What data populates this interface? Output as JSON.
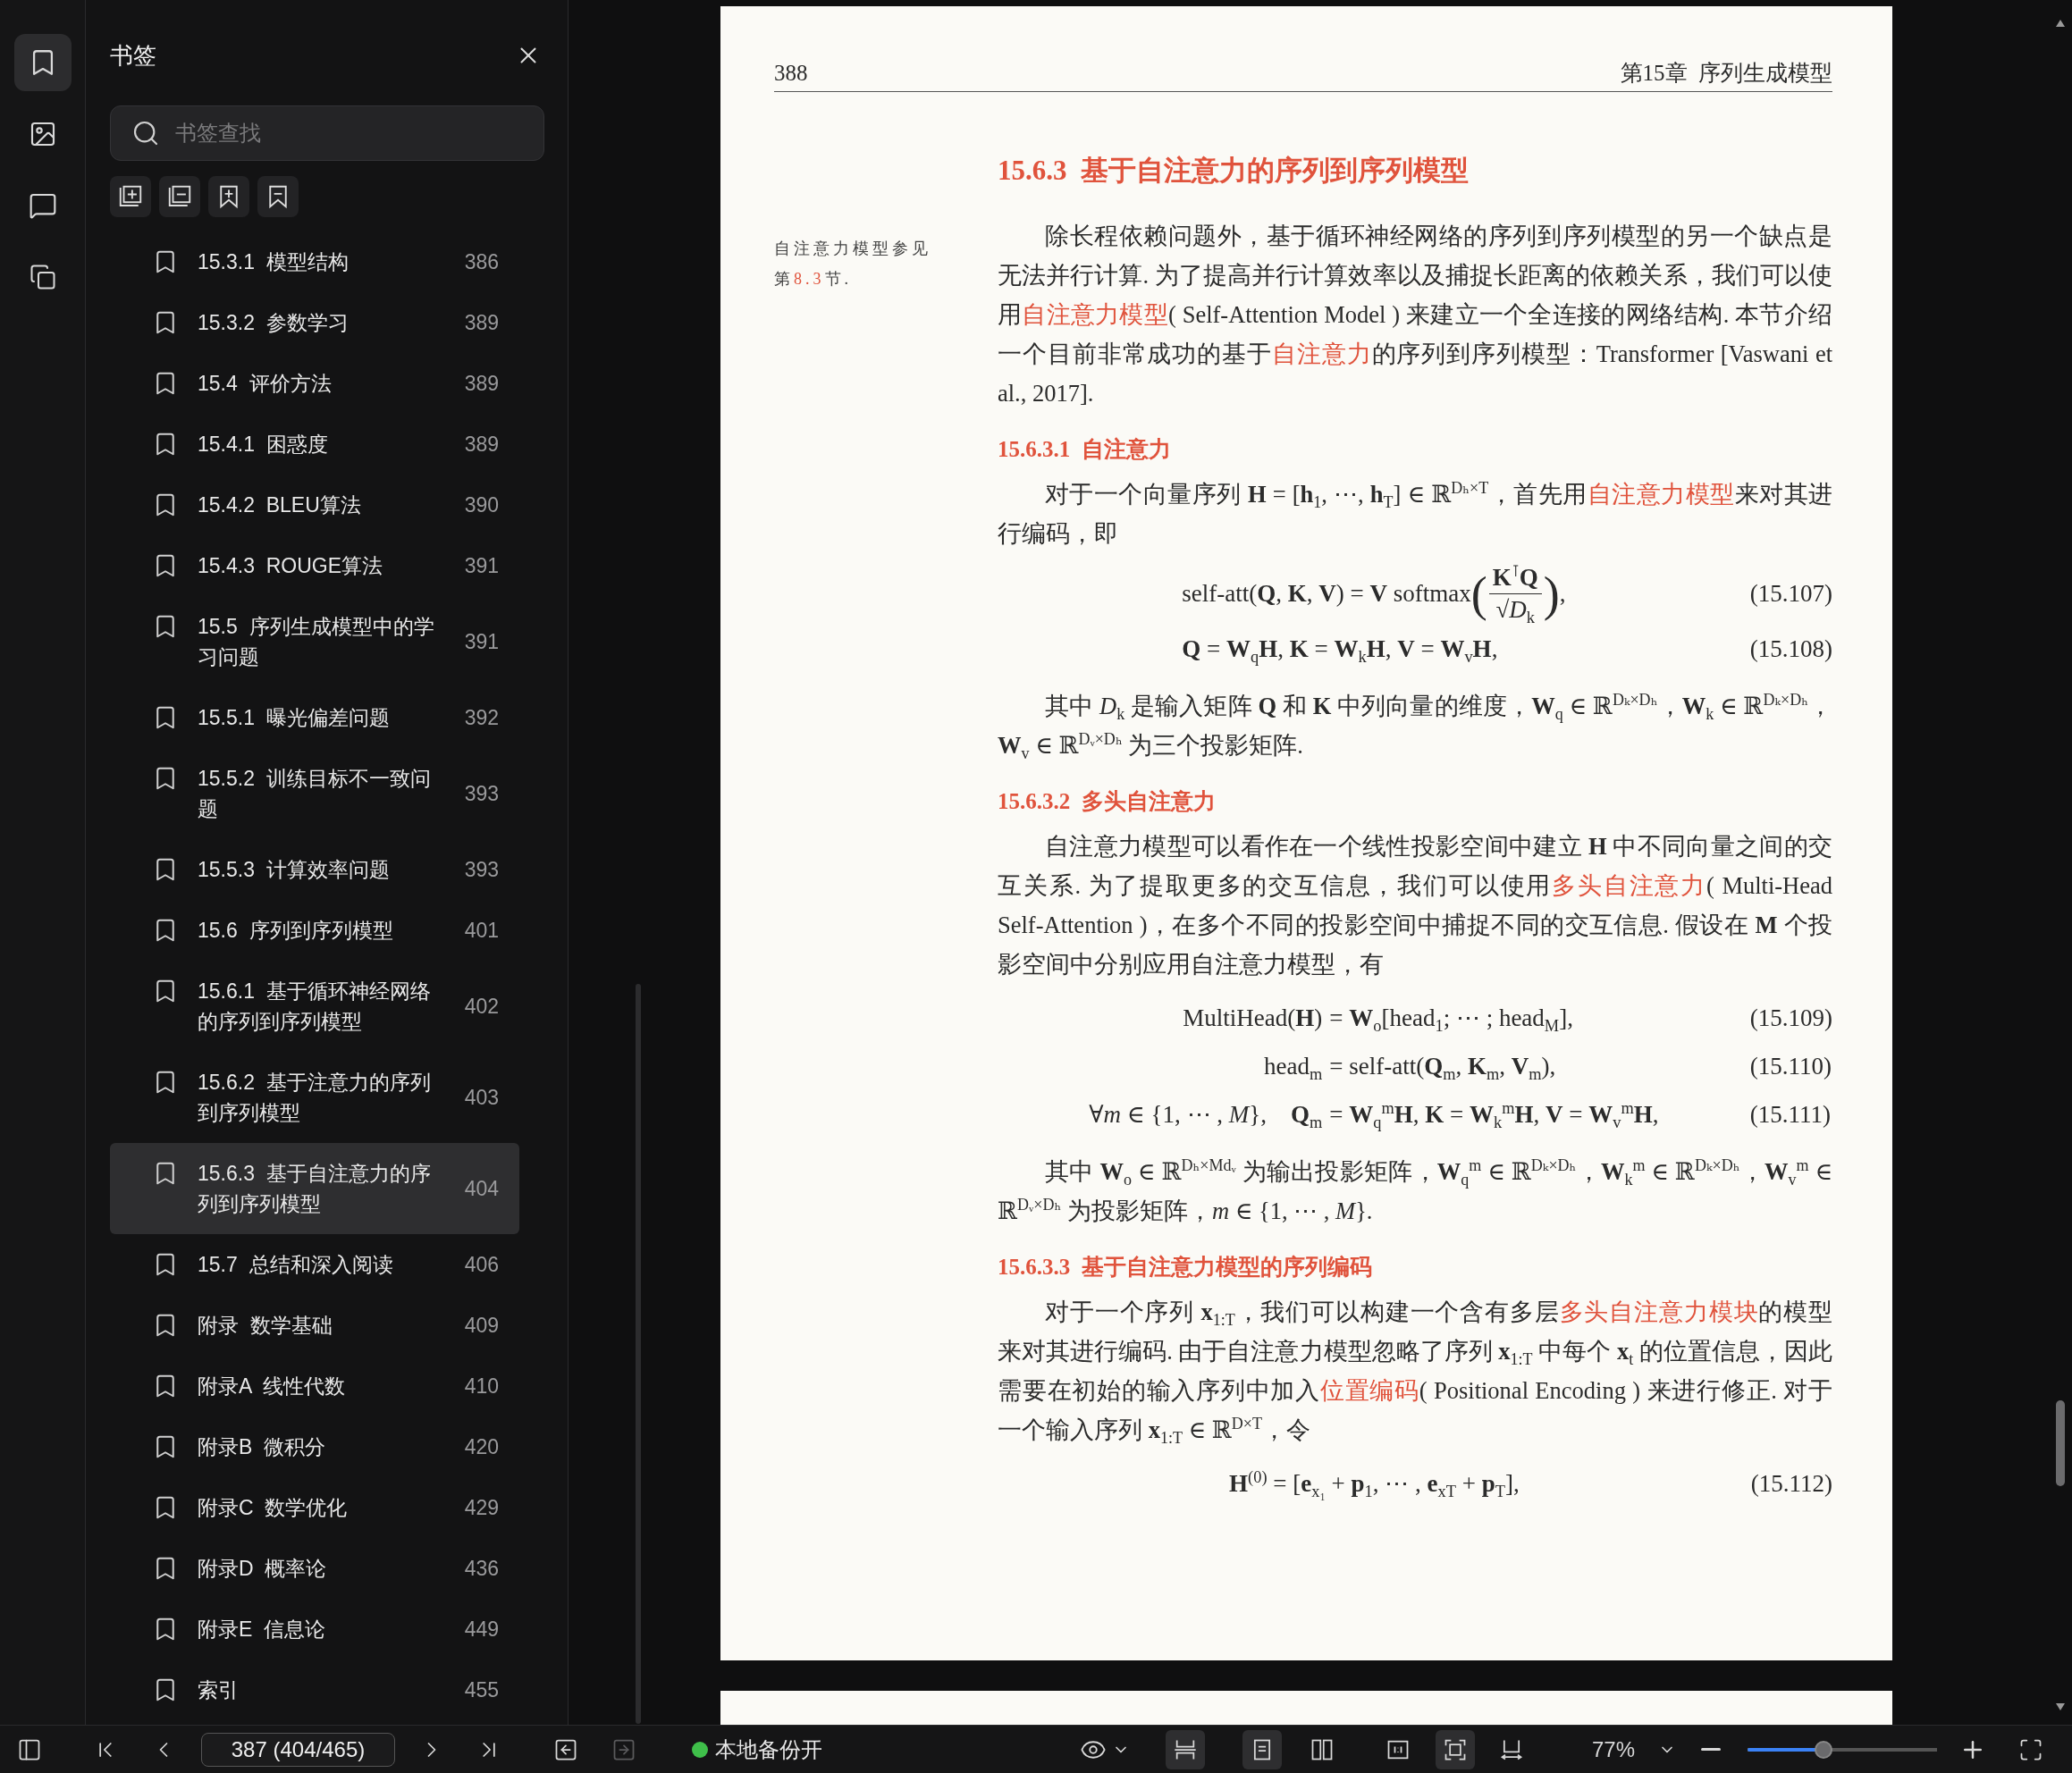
{
  "rail": [
    {
      "kind": "bookmarks",
      "selected": true
    },
    {
      "kind": "images",
      "selected": false
    },
    {
      "kind": "comments",
      "selected": false
    },
    {
      "kind": "copy",
      "selected": false
    }
  ],
  "panel": {
    "title": "书签",
    "search": {
      "placeholder": "书签查找"
    },
    "tools": [
      {
        "kind": "expand"
      },
      {
        "kind": "collapse"
      },
      {
        "kind": "add"
      },
      {
        "kind": "remove"
      }
    ],
    "bookmarks": [
      {
        "label": "15.3.1  模型结构",
        "page": "386",
        "selected": false
      },
      {
        "label": "15.3.2  参数学习",
        "page": "389",
        "selected": false
      },
      {
        "label": "15.4  评价方法",
        "page": "389",
        "selected": false
      },
      {
        "label": "15.4.1  困惑度",
        "page": "389",
        "selected": false
      },
      {
        "label": "15.4.2  BLEU算法",
        "page": "390",
        "selected": false
      },
      {
        "label": "15.4.3  ROUGE算法",
        "page": "391",
        "selected": false
      },
      {
        "label": "15.5  序列生成模型中的学习问题",
        "page": "391",
        "selected": false
      },
      {
        "label": "15.5.1  曝光偏差问题",
        "page": "392",
        "selected": false
      },
      {
        "label": "15.5.2  训练目标不一致问题",
        "page": "393",
        "selected": false
      },
      {
        "label": "15.5.3  计算效率问题",
        "page": "393",
        "selected": false
      },
      {
        "label": "15.6  序列到序列模型",
        "page": "401",
        "selected": false
      },
      {
        "label": "15.6.1  基于循环神经网络的序列到序列模型",
        "page": "402",
        "selected": false
      },
      {
        "label": "15.6.2  基于注意力的序列到序列模型",
        "page": "403",
        "selected": false
      },
      {
        "label": "15.6.3  基于自注意力的序列到序列模型",
        "page": "404",
        "selected": true
      },
      {
        "label": "15.7  总结和深入阅读",
        "page": "406",
        "selected": false
      },
      {
        "label": "附录  数学基础",
        "page": "409",
        "selected": false
      },
      {
        "label": "附录A  线性代数",
        "page": "410",
        "selected": false
      },
      {
        "label": "附录B  微积分",
        "page": "420",
        "selected": false
      },
      {
        "label": "附录C  数学优化",
        "page": "429",
        "selected": false
      },
      {
        "label": "附录D  概率论",
        "page": "436",
        "selected": false
      },
      {
        "label": "附录E  信息论",
        "page": "449",
        "selected": false
      },
      {
        "label": "索引",
        "page": "455",
        "selected": false
      }
    ]
  },
  "page": {
    "header": {
      "page_number": "388",
      "chapter": "第15章  序列生成模型"
    },
    "margin_note": [
      {
        "text": "自注意力模型参见第",
        "link": false
      },
      {
        "text": "8.3",
        "link": true
      },
      {
        "text": "节.",
        "link": false
      }
    ],
    "blocks": [
      {
        "kind": "section",
        "text": "15.6.3  基于自注意力的序列到序列模型"
      },
      {
        "kind": "paragraph",
        "segments": [
          {
            "text": "除长程依赖问题外，基于循环神经网络的序列到序列模型的另一个缺点是无法并行计算. 为了提高并行计算效率以及捕捉长距离的依赖关系，我们可以使用",
            "link": false
          },
          {
            "text": "自注意力模型",
            "link": true
          },
          {
            "text": "( Self-Attention Model ) 来建立一个全连接的网络结构. 本节介绍一个目前非常成功的基于",
            "link": false
          },
          {
            "text": "自注意力",
            "link": true
          },
          {
            "text": "的序列到序列模型：Transformer [Vaswani et al., 2017].",
            "link": false
          }
        ]
      },
      {
        "kind": "subsection",
        "text": "15.6.3.1  自注意力"
      },
      {
        "kind": "paragraph",
        "segments": [
          {
            "text": "对于一个向量序列 **H** = [**h**$_{1}$, ⋯, **h**$_{T}$] ∈ ℝ$^{Dₕ×T}$，首先用",
            "link": false
          },
          {
            "text": "自注意力模型",
            "link": true
          },
          {
            "text": "来对其进行编码，即",
            "link": false
          }
        ]
      },
      {
        "kind": "equations",
        "rows": [
          {
            "parts": [
              {
                "kind": "text",
                "text": "self-att(**Q**, **K**, **V**) = **V** softmax"
              },
              {
                "kind": "delim",
                "text": "("
              },
              {
                "kind": "fraction",
                "numerator": "**K**$^{⊺}$**Q**",
                "denominator": "√*D*$_{k}$"
              },
              {
                "kind": "delim",
                "text": ")"
              },
              {
                "kind": "text",
                "text": ","
              }
            ],
            "number": "(15.107)"
          },
          {
            "parts": [
              {
                "kind": "text",
                "text": "**Q** = **W**$_{q}$**H**, **K** = **W**$_{k}$**H**, **V** = **W**$_{v}$**H**,"
              }
            ],
            "number": "(15.108)"
          }
        ]
      },
      {
        "kind": "paragraph",
        "segments": [
          {
            "text": "其中 *D*$_{k}$ 是输入矩阵 **Q** 和 **K** 中列向量的维度，**W**$_{q}$ ∈ ℝ$^{Dₖ×Dₕ}$，**W**$_{k}$ ∈ ℝ$^{Dₖ×Dₕ}$，**W**$_{v}$ ∈ ℝ$^{Dᵥ×Dₕ}$ 为三个投影矩阵.",
            "link": false
          }
        ]
      },
      {
        "kind": "subsection",
        "text": "15.6.3.2  多头自注意力"
      },
      {
        "kind": "paragraph",
        "segments": [
          {
            "text": "自注意力模型可以看作在一个线性投影空间中建立 **H** 中不同向量之间的交互关系. 为了提取更多的交互信息，我们可以使用",
            "link": false
          },
          {
            "text": "多头自注意力",
            "link": true
          },
          {
            "text": "( Multi-Head Self-Attention )，在多个不同的投影空间中捕捉不同的交互信息. 假设在 **M** 个投影空间中分别应用自注意力模型，有",
            "link": false
          }
        ]
      },
      {
        "kind": "equations",
        "rows": [
          {
            "lhs": "MultiHead(**H**)",
            "parts": [
              {
                "kind": "text",
                "text": "= **W**$_{o}$[head$_{1}$; ⋯ ; head$_{M}$],"
              }
            ],
            "number": "(15.109)"
          },
          {
            "lhs": "head$_{m}$",
            "parts": [
              {
                "kind": "text",
                "text": "= self-att(**Q**$_{m}$, **K**$_{m}$, **V**$_{m}$),"
              }
            ],
            "number": "(15.110)"
          },
          {
            "lhs": "∀*m* ∈ {1, ⋯ , *M*},    **Q**$_{m}$",
            "parts": [
              {
                "kind": "text",
                "text": "= **W**$_{q}$$^{m}$**H**, **K** = **W**$_{k}$$^{m}$**H**, **V** = **W**$_{v}$$^{m}$**H**,"
              }
            ],
            "number": "(15.111)"
          }
        ]
      },
      {
        "kind": "paragraph",
        "segments": [
          {
            "text": "其中 **W**$_{o}$ ∈ ℝ$^{Dₕ×Mdᵥ}$ 为输出投影矩阵，**W**$_{q}$$^{m}$ ∈ ℝ$^{Dₖ×Dₕ}$，**W**$_{k}$$^{m}$ ∈ ℝ$^{Dₖ×Dₕ}$，**W**$_{v}$$^{m}$ ∈ ℝ$^{Dᵥ×Dₕ}$ 为投影矩阵，*m* ∈ {1, ⋯ , *M*}.",
            "link": false
          }
        ]
      },
      {
        "kind": "subsection",
        "text": "15.6.3.3  基于自注意力模型的序列编码"
      },
      {
        "kind": "paragraph",
        "segments": [
          {
            "text": "对于一个序列 **x**$_{1:T}$，我们可以构建一个含有多层",
            "link": false
          },
          {
            "text": "多头自注意力模块",
            "link": true
          },
          {
            "text": "的模型来对其进行编码. 由于自注意力模型忽略了序列 **x**$_{1:T}$ 中每个 **x**$_{t}$ 的位置信息，因此需要在初始的输入序列中加入",
            "link": false
          },
          {
            "text": "位置编码",
            "link": true
          },
          {
            "text": "( Positional Encoding ) 来进行修正. 对于一个输入序列 **x**$_{1:T}$ ∈ ℝ$^{D×T}$，令",
            "link": false
          }
        ]
      },
      {
        "kind": "equations",
        "rows": [
          {
            "parts": [
              {
                "kind": "text",
                "text": "**H**$^{(0)}$ = [**e**$_{x₁}$ + **p**$_{1}$, ⋯ , **e**$_{xT}$ + **p**$_{T}$],"
              }
            ],
            "number": "(15.112)"
          }
        ]
      }
    ]
  },
  "bottom_bar": {
    "nav": [
      {
        "kind": "back",
        "disabled": false
      },
      {
        "kind": "forward",
        "disabled": true
      }
    ],
    "page_field": {
      "value": "387 (404/465)"
    },
    "backup": {
      "label": "本地备份开",
      "on": true
    },
    "views": [
      {
        "kind": "split",
        "selected": true
      },
      {
        "kind": "single",
        "selected": true
      },
      {
        "kind": "double",
        "selected": false
      },
      {
        "kind": "actual",
        "selected": false
      },
      {
        "kind": "fit",
        "selected": true
      },
      {
        "kind": "width",
        "selected": false
      }
    ],
    "zoom": {
      "value": "77%",
      "level": 0.4
    }
  }
}
